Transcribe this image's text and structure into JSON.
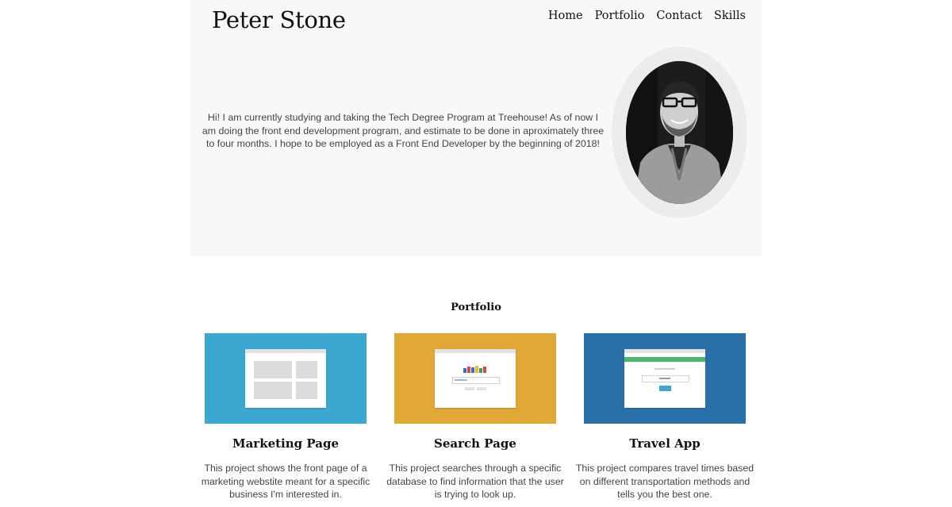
{
  "header": {
    "title": "Peter Stone",
    "nav": [
      {
        "label": "Home"
      },
      {
        "label": "Portfolio"
      },
      {
        "label": "Contact"
      },
      {
        "label": "Skills"
      }
    ]
  },
  "intro": {
    "text": "Hi! I am currently studying and taking the Tech Degree Program at Treehouse! As of now I am doing the front end development program, and estimate to be done in aproximately three to four months. I hope to be employed as a Front End Developer by the beginning of 2018!"
  },
  "portfolio": {
    "heading": "Portfolio",
    "items": [
      {
        "title": "Marketing Page",
        "description": "This project shows the front page of a marketing webstite meant for a specific business I'm interested in.",
        "color": "#3aa8d0"
      },
      {
        "title": "Search Page",
        "description": "This project searches through a specific database to find information that the user is trying to look up.",
        "color": "#e0a834"
      },
      {
        "title": "Travel App",
        "description": "This project compares travel times based on different transportation methods and tells you the best one.",
        "color": "#2a70a8"
      }
    ]
  },
  "colors": {
    "hero_bg": "#f8f8f8",
    "avatar_ring": "#ececec",
    "travel_accent": "#4cb86c"
  }
}
